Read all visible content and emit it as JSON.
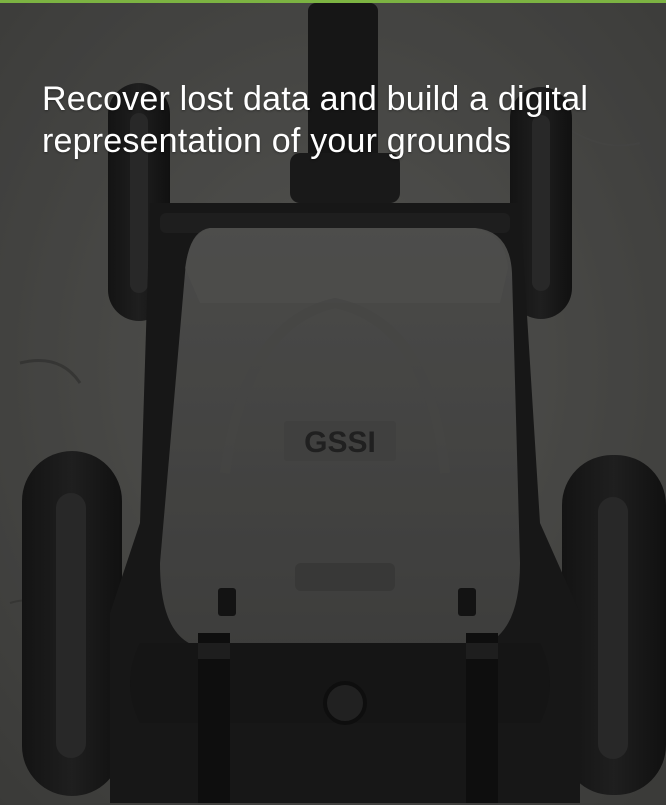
{
  "headline": "Recover lost data and build a digital representation of your grounds",
  "device_logo_text": "GSSI",
  "colors": {
    "accent_bar": "#7cb342",
    "headline_text": "#ffffff",
    "overlay": "rgba(10,10,10,0.35)"
  },
  "image": {
    "subject": "ground-penetrating-radar-cart"
  }
}
